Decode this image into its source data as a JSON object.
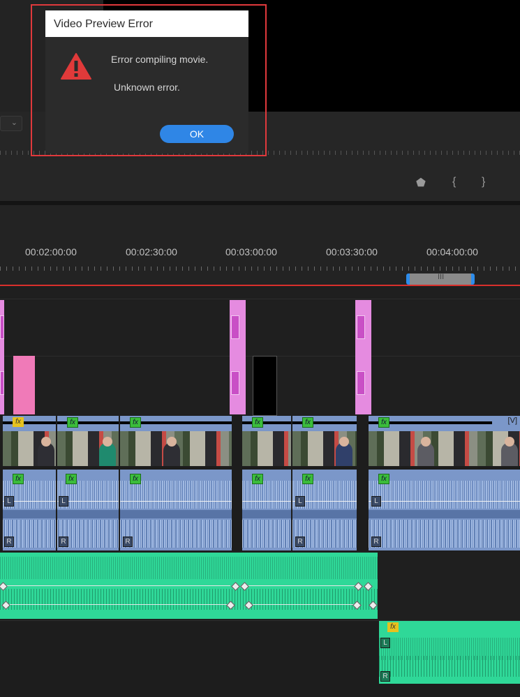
{
  "dialog": {
    "title": "Video Preview Error",
    "message_line1": "Error compiling movie.",
    "message_line2": "Unknown error.",
    "ok_label": "OK",
    "icon": "warning-icon",
    "highlight_color": "#e0393c",
    "button_color": "#2f86e6"
  },
  "monitor": {
    "zoom_dropdown_icon": "chevron-down-icon",
    "controls": [
      "marker-icon",
      "mark-in-icon",
      "mark-out-icon"
    ],
    "control_glyphs": [
      "⬟",
      "{",
      "}"
    ]
  },
  "timeline": {
    "timecodes": [
      "00:02:00:00",
      "00:02:30:00",
      "00:03:00:00",
      "00:03:30:00",
      "00:04:00:00"
    ],
    "playhead_color": "#d9302c",
    "scroll_handle_glyph": "III",
    "video_clip_title_tail": "[V]",
    "fx_label": "fx",
    "channel_left": "L",
    "channel_right": "R"
  },
  "colors": {
    "video_clip": "#7b97c9",
    "music_clip": "#2fd898",
    "title_clip": "#e58be0",
    "fx_badge": "#e6c21e",
    "fx_badge_applied": "#3bbd3b"
  }
}
